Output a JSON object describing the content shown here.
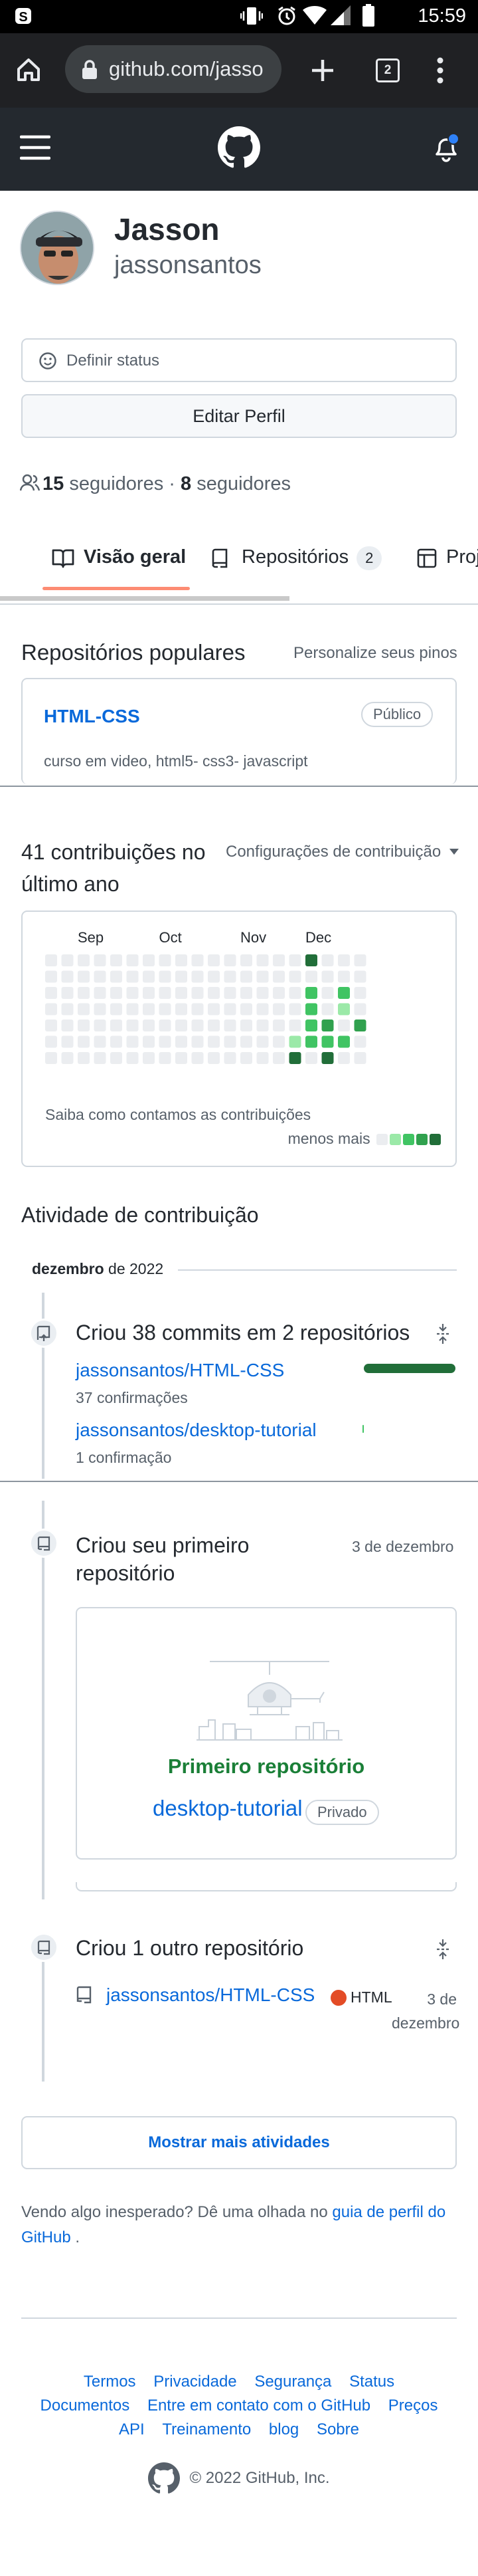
{
  "statusbar": {
    "time": "15:59"
  },
  "browser": {
    "url": "github.com/jasso",
    "tab_count": "2"
  },
  "profile": {
    "name": "Jasson",
    "login": "jassonsantos",
    "set_status": "Definir status",
    "edit_profile": "Editar Perfil",
    "followers_count": "15",
    "followers_label": "seguidores",
    "following_count": "8",
    "following_label": "seguidores"
  },
  "tabs": [
    {
      "label": "Visão geral",
      "active": true
    },
    {
      "label": "Repositórios",
      "count": "2"
    },
    {
      "label": "Proj"
    }
  ],
  "popular": {
    "title": "Repositórios populares",
    "customize": "Personalize seus pinos",
    "repo": {
      "name": "HTML-CSS",
      "visibility": "Público",
      "description": "curso em video, html5- css3- javascript"
    }
  },
  "contributions": {
    "title": "41 contribuições no último ano",
    "settings": "Configurações de contribuição",
    "footnote": "Saiba como contamos as contribuições",
    "legend_less": "menos",
    "legend_more": "mais",
    "colors": {
      "empty": "#ebedf0",
      "l1": "#9be9a8",
      "l2": "#40c463",
      "l3": "#30a14e",
      "l4": "#216e39"
    }
  },
  "chart_data": {
    "type": "heatmap",
    "month_labels": [
      "",
      "Sep",
      "Oct",
      "Nov",
      "Dec"
    ],
    "weeks": 20,
    "days": 7,
    "cells": [
      {
        "week": 16,
        "day": 0,
        "level": 4
      },
      {
        "week": 16,
        "day": 1,
        "level": 0
      },
      {
        "week": 16,
        "day": 2,
        "level": 2
      },
      {
        "week": 16,
        "day": 3,
        "level": 2
      },
      {
        "week": 16,
        "day": 4,
        "level": 2
      },
      {
        "week": 16,
        "day": 5,
        "level": 2
      },
      {
        "week": 15,
        "day": 5,
        "level": 1
      },
      {
        "week": 15,
        "day": 6,
        "level": 4
      },
      {
        "week": 16,
        "day": 6,
        "level": 0
      },
      {
        "week": 17,
        "day": 4,
        "level": 3
      },
      {
        "week": 17,
        "day": 5,
        "level": 2
      },
      {
        "week": 17,
        "day": 6,
        "level": 4
      },
      {
        "week": 18,
        "day": 2,
        "level": 2
      },
      {
        "week": 18,
        "day": 3,
        "level": 1
      },
      {
        "week": 18,
        "day": 5,
        "level": 2
      },
      {
        "week": 19,
        "day": 4,
        "level": 3
      }
    ]
  },
  "activity": {
    "title": "Atividade de contribuição",
    "month": "dezembro",
    "year": "2022",
    "events": [
      {
        "title": "Criou 38 commits em 2 repositórios",
        "repos": [
          {
            "name": "jassonsantos/HTML-CSS",
            "detail": "37 confirmações"
          },
          {
            "name": "jassonsantos/desktop-tutorial",
            "detail": "1 confirmação"
          }
        ]
      },
      {
        "title": "Criou seu primeiro repositório",
        "date": "3 de dezembro",
        "card_title": "Primeiro repositório",
        "repo": "desktop-tutorial",
        "visibility": "Privado"
      },
      {
        "title": "Criou 1 outro repositório",
        "repo": "jassonsantos/HTML-CSS",
        "language": "HTML",
        "date": "3 de dezembro"
      }
    ],
    "more": "Mostrar mais atividades"
  },
  "footer": {
    "unexpected": "Vendo algo inesperado? Dê uma olhada no",
    "guide_link": "guia de perfil do GitHub",
    "unexpected_end": ".",
    "links_row1": [
      "Termos",
      "Privacidade",
      "Segurança",
      "Status"
    ],
    "links_row2": [
      "Documentos",
      "Entre em contato com o GitHub",
      "Preços"
    ],
    "links_row3": [
      "API",
      "Treinamento",
      "blog",
      "Sobre"
    ],
    "copyright": "© 2022 GitHub, Inc."
  }
}
